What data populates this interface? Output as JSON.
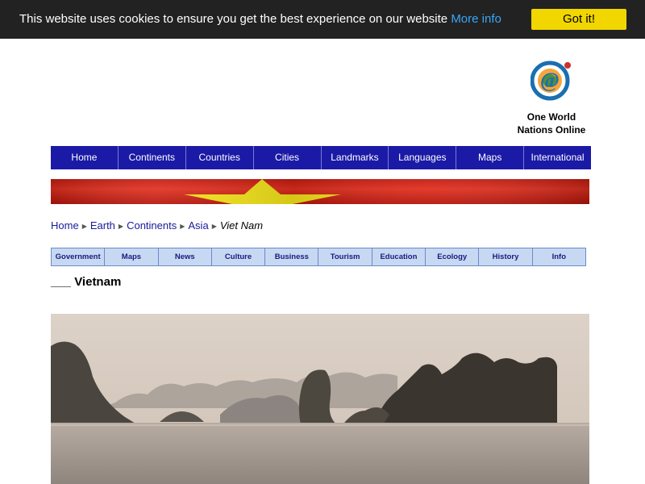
{
  "cookie": {
    "message": "This website uses cookies to ensure you get the best experience on our website",
    "more_info": "More info",
    "accept": "Got it!"
  },
  "logo": {
    "line1": "One World",
    "line2": "Nations Online"
  },
  "nav": {
    "items": [
      "Home",
      "Continents",
      "Countries",
      "Cities",
      "Landmarks",
      "Languages",
      "Maps",
      "International"
    ]
  },
  "breadcrumb": {
    "items": [
      "Home",
      "Earth",
      "Continents",
      "Asia"
    ],
    "current": "Viet Nam"
  },
  "subnav": {
    "items": [
      "Government",
      "Maps",
      "News",
      "Culture",
      "Business",
      "Tourism",
      "Education",
      "Ecology",
      "History",
      "Info"
    ]
  },
  "page": {
    "title": "___ Vietnam"
  },
  "colors": {
    "nav_bg": "#1a1aa6",
    "cookie_bg": "#222222",
    "cookie_btn": "#f1d600",
    "subnav_bg": "#c7d8f2",
    "flag_red": "#da251d",
    "flag_yellow": "#ffff00"
  }
}
